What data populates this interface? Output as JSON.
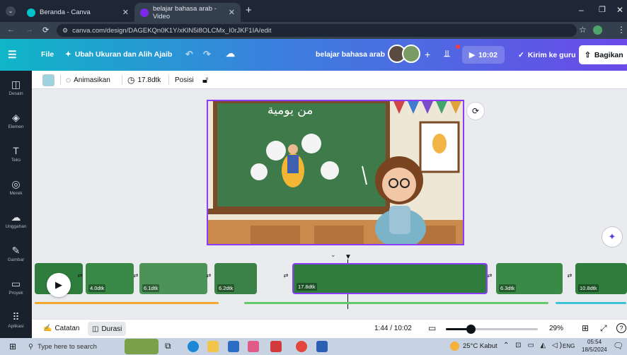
{
  "browser": {
    "tabs": [
      {
        "title": "Beranda - Canva",
        "active": false,
        "color": "#00c4cc"
      },
      {
        "title": "belajar bahasa arab - Video",
        "active": true,
        "color": "#7d2ae8"
      }
    ],
    "url": "canva.com/design/DAGEKQn0K1Y/xKlN5i8OLCMx_I0rJKF1IA/edit"
  },
  "header": {
    "file_label": "File",
    "resize_label": "Ubah Ukuran dan Alih Ajaib",
    "doc_title": "belajar bahasa arab",
    "play_time": "10:02",
    "send_label": "Kirim ke guru",
    "share_label": "Bagikan"
  },
  "sidebar": {
    "items": [
      {
        "label": "Desain",
        "icon": "layout-icon"
      },
      {
        "label": "Elemen",
        "icon": "shapes-icon"
      },
      {
        "label": "Teks",
        "icon": "text-icon"
      },
      {
        "label": "Merek",
        "icon": "brand-icon"
      },
      {
        "label": "Unggahan",
        "icon": "upload-icon"
      },
      {
        "label": "Gambar",
        "icon": "draw-icon"
      },
      {
        "label": "Proyek",
        "icon": "folder-icon"
      },
      {
        "label": "Aplikasi",
        "icon": "apps-icon"
      }
    ]
  },
  "toolbar": {
    "animate_label": "Animasikan",
    "duration_label": "17.8dtk",
    "position_label": "Posisi",
    "color_swatch": "#9fd3e0"
  },
  "slide": {
    "arabic_title": "من يومية"
  },
  "timeline": {
    "clips": [
      {
        "duration": ""
      },
      {
        "duration": "4.0dtk"
      },
      {
        "duration": "6.1dtk"
      },
      {
        "duration": "6.2dtk"
      },
      {
        "duration": "17.8dtk",
        "selected": true
      },
      {
        "duration": "6.3dtk"
      },
      {
        "duration": "10.8dtk"
      }
    ]
  },
  "bottom": {
    "notes_label": "Catatan",
    "duration_label": "Durasi",
    "time_readout": "1:44 / 10:02",
    "zoom": "29%"
  },
  "taskbar": {
    "search_placeholder": "Type here to search",
    "weather": "25°C Kabut",
    "lang": "ENG",
    "time": "05:54",
    "date": "18/5/2024"
  }
}
